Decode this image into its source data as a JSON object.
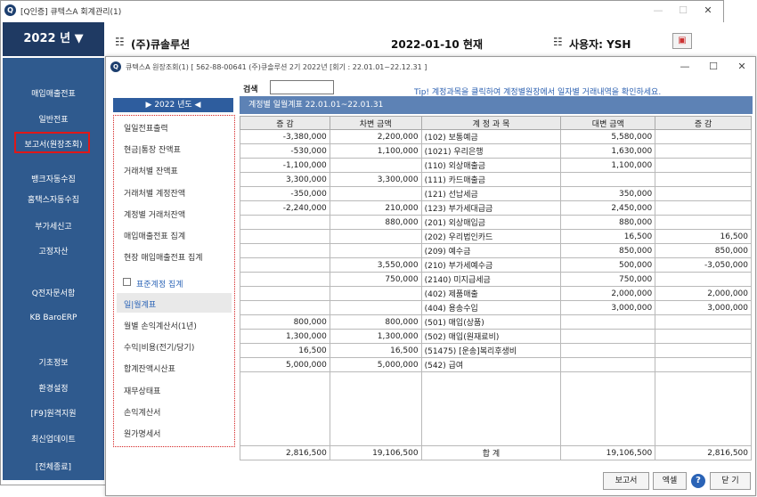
{
  "main_window": {
    "title": "[Q인증] 큐텍스A  회계관리(1)",
    "year": "2022 년 ▼",
    "company": "(주)큐솔루션",
    "date": "2022-01-10 현재",
    "user": "사용자: YSH",
    "menu_glyph": "☷"
  },
  "sidebar": {
    "items": [
      "매입매출전표",
      "일반전표",
      "보고서(원장조회)",
      "뱅크자동수집",
      "홈택스자동수집",
      "부가세신고",
      "고정자산",
      "Q전자문서함",
      "KB BaroERP",
      "기초정보",
      "환경설정",
      "[F9]원격지원",
      "최신업데이트",
      "[전체종료]"
    ]
  },
  "child_window": {
    "title": "큐텍스A 원장조회(1)  [ 562-88-00641 (주)큐솔루션 2기 2022년 [회기 : 22.01.01~22.12.31 ]",
    "year_nav": "▶  2022 년도  ◀",
    "search_label": "검색",
    "search_value": "",
    "tip": "Tip! 계정과목을 클릭하여 계정별원장에서 일자별 거래내역을 확인하세요.",
    "table_title": "계정별 일월계표  22.01.01~22.01.31",
    "menu": [
      "일일전표출력",
      "현금|통장 잔액표",
      "거래처별 잔액표",
      "거래처별 계정잔액",
      "계정별 거래처잔액",
      "매입매출전표 집계",
      "현장 매입매출전표 집계",
      "표준계정 집계",
      "일|월계표",
      "월별 손익계산서(1년)",
      "수익|비용(전기/당기)",
      "합계잔액시산표",
      "재무상태표",
      "손익계산서",
      "원가명세서"
    ],
    "columns": [
      "증 감",
      "차변 금액",
      "계 정 과 목",
      "대변 금액",
      "증 감"
    ],
    "rows": [
      [
        "-3,380,000",
        "2,200,000",
        "(102) 보통예금",
        "5,580,000",
        ""
      ],
      [
        "-530,000",
        "1,100,000",
        "(1021) 우리은행",
        "1,630,000",
        ""
      ],
      [
        "-1,100,000",
        "",
        "(110) 외상매출금",
        "1,100,000",
        ""
      ],
      [
        "3,300,000",
        "3,300,000",
        "(111) 카드매출금",
        "",
        ""
      ],
      [
        "-350,000",
        "",
        "(121) 선납세금",
        "350,000",
        ""
      ],
      [
        "-2,240,000",
        "210,000",
        "(123) 부가세대급금",
        "2,450,000",
        ""
      ],
      [
        "",
        "880,000",
        "(201) 외상매입금",
        "880,000",
        ""
      ],
      [
        "",
        "",
        "(202) 우리법인카드",
        "16,500",
        "16,500"
      ],
      [
        "",
        "",
        "(209) 예수금",
        "850,000",
        "850,000"
      ],
      [
        "",
        "3,550,000",
        "(210) 부가세예수금",
        "500,000",
        "-3,050,000"
      ],
      [
        "",
        "750,000",
        "(2140) 미지급세금",
        "750,000",
        ""
      ],
      [
        "",
        "",
        "(402) 제품매출",
        "2,000,000",
        "2,000,000"
      ],
      [
        "",
        "",
        "(404) 용송수입",
        "3,000,000",
        "3,000,000"
      ],
      [
        "800,000",
        "800,000",
        "(501) 매입(상품)",
        "",
        ""
      ],
      [
        "1,300,000",
        "1,300,000",
        "(502) 매입(원재료비)",
        "",
        ""
      ],
      [
        "16,500",
        "16,500",
        "(51475) [운송]복리후생비",
        "",
        ""
      ],
      [
        "5,000,000",
        "5,000,000",
        "(542) 급여",
        "",
        ""
      ]
    ],
    "total": [
      "2,816,500",
      "19,106,500",
      "합    계",
      "19,106,500",
      "2,816,500"
    ],
    "buttons": {
      "report": "보고서",
      "excel": "엑셀",
      "help": "?",
      "close": "닫 기"
    }
  }
}
